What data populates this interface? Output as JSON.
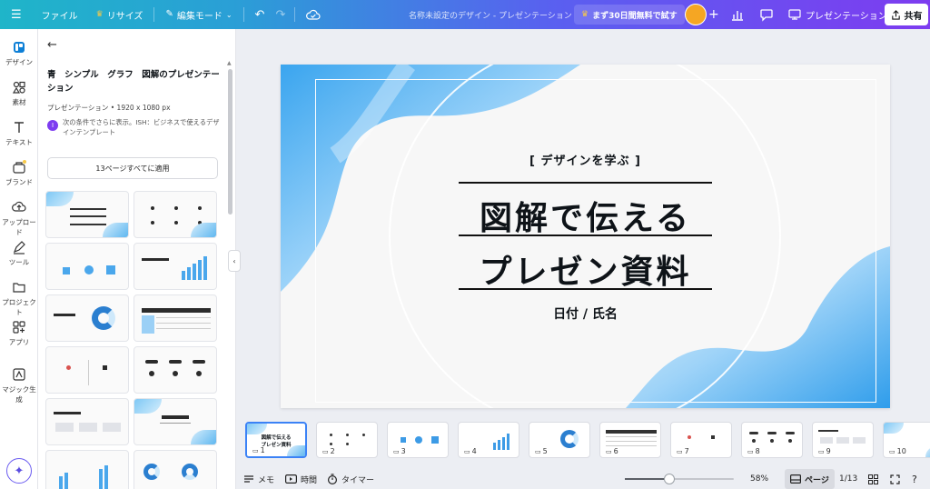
{
  "topbar": {
    "file": "ファイル",
    "resize": "リサイズ",
    "edit_mode": "編集モード",
    "doc_title": "名称未設定のデザイン - プレゼンテーション",
    "trial": "まず30日間無料で試す",
    "present": "プレゼンテーション",
    "share": "共有"
  },
  "rail": {
    "items": [
      {
        "label": "デザイン",
        "icon": "design-icon"
      },
      {
        "label": "素材",
        "icon": "elements-icon"
      },
      {
        "label": "テキスト",
        "icon": "text-icon"
      },
      {
        "label": "ブランド",
        "icon": "brand-icon"
      },
      {
        "label": "アップロード",
        "icon": "upload-icon"
      },
      {
        "label": "ツール",
        "icon": "draw-icon"
      },
      {
        "label": "プロジェクト",
        "icon": "folder-icon"
      },
      {
        "label": "アプリ",
        "icon": "apps-icon"
      },
      {
        "label": "マジック生成",
        "icon": "magic-icon"
      }
    ]
  },
  "panel": {
    "title": "青　シンプル　グラフ　図解のプレゼンテーション",
    "meta": "プレゼンテーション • 1920 x 1080 px",
    "creator_initial": "I",
    "condition": "次の条件でさらに表示。ISH：ビジネスで使えるデザインテンプレート",
    "apply_all": "13ページすべてに適用"
  },
  "slide": {
    "subtitle": "[ デザインを学ぶ ]",
    "title_line1": "図解で伝える",
    "title_line2": "プレゼン資料",
    "date_name": "日付 / 氏名",
    "colors": {
      "accent": "#4aa7ec",
      "light": "#cfe9fb"
    }
  },
  "filmstrip": {
    "pages": [
      "1",
      "2",
      "3",
      "4",
      "5",
      "6",
      "7",
      "8",
      "9",
      "10"
    ],
    "thumb1_title_a": "図解で伝える",
    "thumb1_title_b": "プレゼン資料"
  },
  "bottombar": {
    "memo": "メモ",
    "time": "時間",
    "timer": "タイマー",
    "zoom": "58%",
    "zoom_fraction": 0.41,
    "pages": "ページ",
    "page_count": "1/13"
  }
}
